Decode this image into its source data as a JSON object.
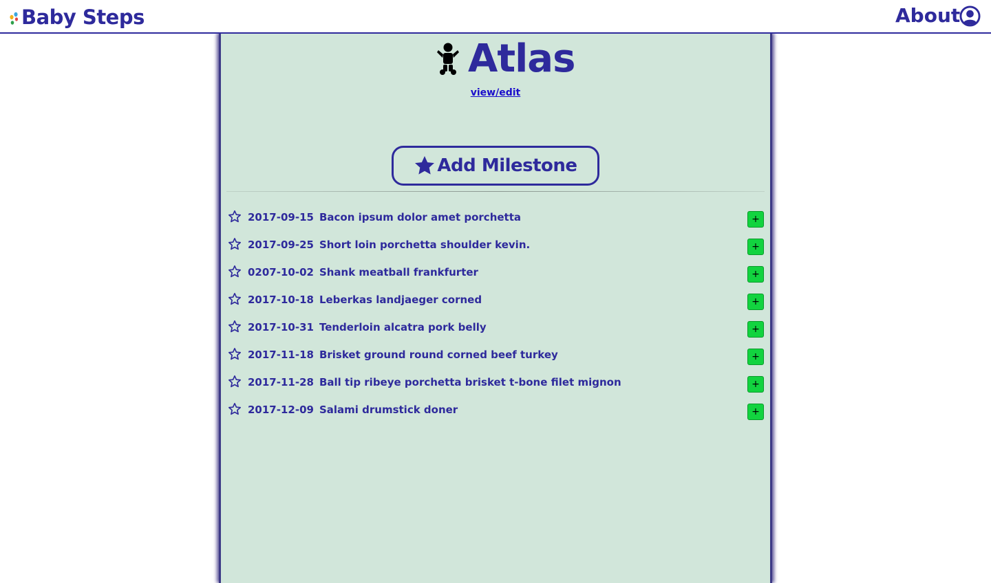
{
  "nav": {
    "brand": "Baby Steps",
    "about": "About"
  },
  "baby": {
    "name": "Atlas",
    "view_edit": "view/edit"
  },
  "add_milestone": {
    "label": "Add Milestone"
  },
  "milestones": [
    {
      "date": "2017-09-15",
      "title": "Bacon ipsum dolor amet porchetta",
      "plus": "+"
    },
    {
      "date": "2017-09-25",
      "title": "Short loin porchetta shoulder kevin.",
      "plus": "+"
    },
    {
      "date": "0207-10-02",
      "title": "Shank meatball frankfurter",
      "plus": "+"
    },
    {
      "date": "2017-10-18",
      "title": "Leberkas landjaeger corned",
      "plus": "+"
    },
    {
      "date": "2017-10-31",
      "title": "Tenderloin alcatra pork belly",
      "plus": "+"
    },
    {
      "date": "2017-11-18",
      "title": "Brisket ground round corned beef turkey",
      "plus": "+"
    },
    {
      "date": "2017-11-28",
      "title": "Ball tip ribeye porchetta brisket t-bone filet mignon",
      "plus": "+"
    },
    {
      "date": "2017-12-09",
      "title": "Salami drumstick doner",
      "plus": "+"
    }
  ],
  "colors": {
    "brand": "#2e2a9c",
    "panel_bg": "#d1e6da",
    "plus_button": "#12d33f",
    "link": "#1a0dcc"
  },
  "icons": {
    "brand_logo": "footprints-icon",
    "user": "user-circle-icon",
    "baby": "baby-icon",
    "add_star": "star-solid-icon",
    "milestone_star": "star-outline-icon"
  }
}
